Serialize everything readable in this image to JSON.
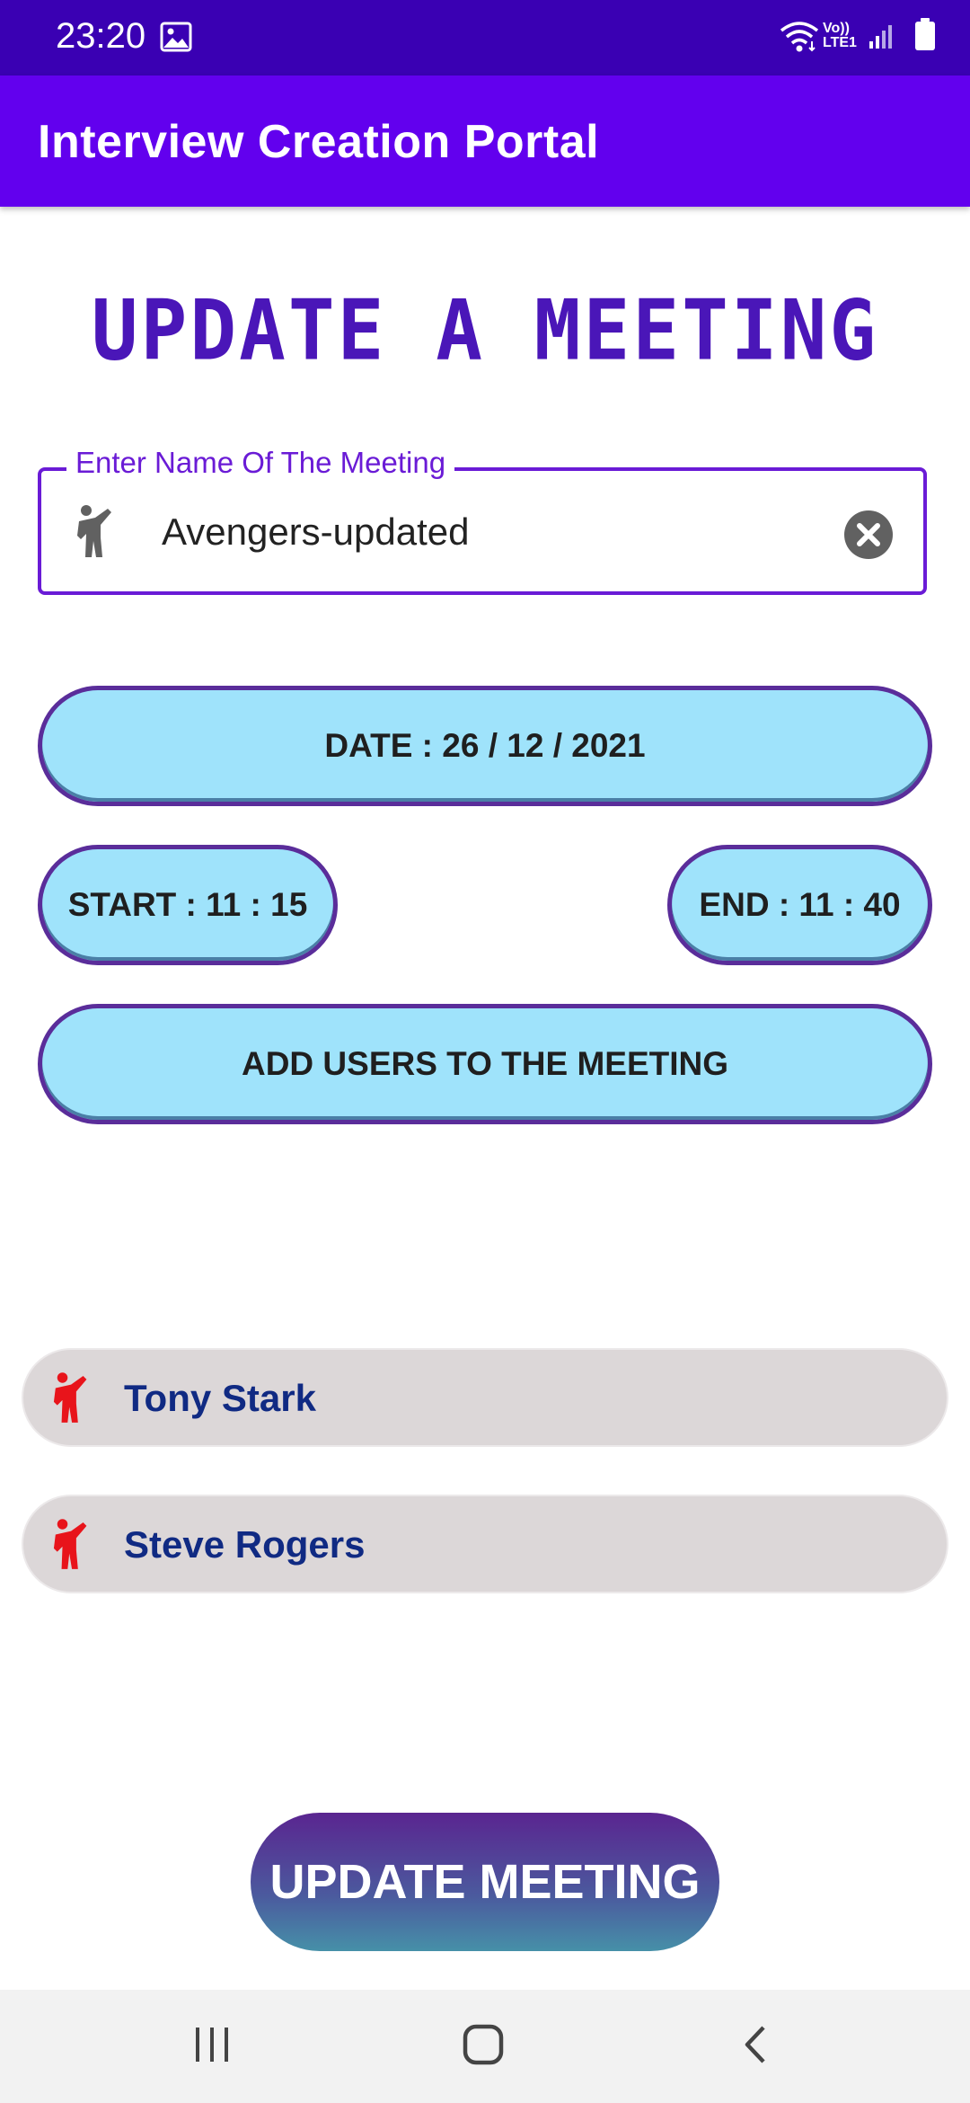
{
  "status_bar": {
    "time": "23:20",
    "icons": [
      "gallery-icon",
      "wifi-icon",
      "volte-lte-icon",
      "signal-icon",
      "battery-icon"
    ],
    "network_label_top": "Vo))",
    "network_label_bottom": "LTE1"
  },
  "app_bar": {
    "title": "Interview Creation Portal",
    "color": "#6200EE"
  },
  "heading": "UPDATE A MEETING",
  "meeting_name": {
    "label": "Enter Name Of The Meeting",
    "value": "Avengers-updated",
    "leading_icon": "person-waving-icon",
    "trailing_icon": "clear-icon"
  },
  "date_button": "DATE : 26  /  12  /  2021",
  "start_button": "START : 11 : 15",
  "end_button": "END : 11 : 40",
  "add_users_button": "ADD USERS TO THE MEETING",
  "users": [
    {
      "name": "Tony Stark",
      "icon": "person-waving-icon"
    },
    {
      "name": "Steve Rogers",
      "icon": "person-waving-icon"
    }
  ],
  "update_button": "UPDATE MEETING",
  "nav_bar": {
    "buttons": [
      "recent-apps-icon",
      "home-icon",
      "back-icon"
    ]
  },
  "colors": {
    "accent": "#6A1BD6",
    "pill_fill": "#9FE3FB",
    "user_chip": "#DCD7D8",
    "user_icon": "#E8141B",
    "user_text": "#102A83"
  }
}
